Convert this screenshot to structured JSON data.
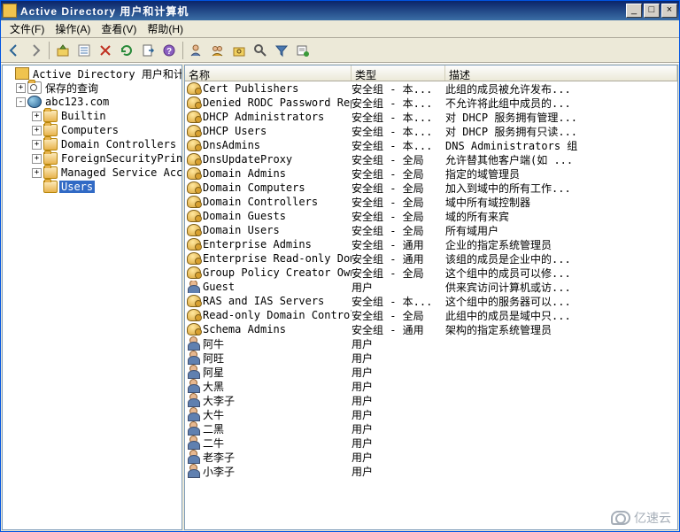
{
  "window": {
    "title": "Active Directory 用户和计算机",
    "min_label": "_",
    "max_label": "□",
    "close_label": "×"
  },
  "menu": {
    "file": "文件(F)",
    "action": "操作(A)",
    "view": "查看(V)",
    "help": "帮助(H)"
  },
  "tree": {
    "root": "Active Directory 用户和计算机",
    "saved_queries": "保存的查询",
    "domain": "abc123.com",
    "children": [
      {
        "label": "Builtin",
        "exp": "+"
      },
      {
        "label": "Computers",
        "exp": "+"
      },
      {
        "label": "Domain Controllers",
        "exp": "+"
      },
      {
        "label": "ForeignSecurityPrincipals",
        "exp": "+"
      },
      {
        "label": "Managed Service Accounts",
        "exp": "+"
      },
      {
        "label": "Users",
        "exp": "",
        "selected": true
      }
    ]
  },
  "columns": {
    "name": "名称",
    "type": "类型",
    "desc": "描述"
  },
  "items": [
    {
      "icon": "grp",
      "name": "Cert Publishers",
      "type": "安全组 - 本...",
      "desc": "此组的成员被允许发布..."
    },
    {
      "icon": "grp",
      "name": "Denied RODC Password Rep...",
      "type": "安全组 - 本...",
      "desc": "不允许将此组中成员的..."
    },
    {
      "icon": "grp",
      "name": "DHCP Administrators",
      "type": "安全组 - 本...",
      "desc": "对 DHCP 服务拥有管理..."
    },
    {
      "icon": "grp",
      "name": "DHCP Users",
      "type": "安全组 - 本...",
      "desc": "对 DHCP 服务拥有只读..."
    },
    {
      "icon": "grp",
      "name": "DnsAdmins",
      "type": "安全组 - 本...",
      "desc": "DNS Administrators 组"
    },
    {
      "icon": "grp",
      "name": "DnsUpdateProxy",
      "type": "安全组 - 全局",
      "desc": "允许替其他客户端(如 ..."
    },
    {
      "icon": "grp",
      "name": "Domain Admins",
      "type": "安全组 - 全局",
      "desc": "指定的域管理员"
    },
    {
      "icon": "grp",
      "name": "Domain Computers",
      "type": "安全组 - 全局",
      "desc": "加入到域中的所有工作..."
    },
    {
      "icon": "grp",
      "name": "Domain Controllers",
      "type": "安全组 - 全局",
      "desc": "域中所有域控制器"
    },
    {
      "icon": "grp",
      "name": "Domain Guests",
      "type": "安全组 - 全局",
      "desc": "域的所有来宾"
    },
    {
      "icon": "grp",
      "name": "Domain Users",
      "type": "安全组 - 全局",
      "desc": "所有域用户"
    },
    {
      "icon": "grp",
      "name": "Enterprise Admins",
      "type": "安全组 - 通用",
      "desc": "企业的指定系统管理员"
    },
    {
      "icon": "grp",
      "name": "Enterprise Read-only Dom...",
      "type": "安全组 - 通用",
      "desc": "该组的成员是企业中的..."
    },
    {
      "icon": "grp",
      "name": "Group Policy Creator Owners",
      "type": "安全组 - 全局",
      "desc": "这个组中的成员可以修..."
    },
    {
      "icon": "usr",
      "name": "Guest",
      "type": "用户",
      "desc": "供来宾访问计算机或访..."
    },
    {
      "icon": "grp",
      "name": "RAS and IAS Servers",
      "type": "安全组 - 本...",
      "desc": "这个组中的服务器可以..."
    },
    {
      "icon": "grp",
      "name": "Read-only Domain Control...",
      "type": "安全组 - 全局",
      "desc": "此组中的成员是域中只..."
    },
    {
      "icon": "grp",
      "name": "Schema Admins",
      "type": "安全组 - 通用",
      "desc": "架构的指定系统管理员"
    },
    {
      "icon": "usr",
      "name": "阿牛",
      "type": "用户",
      "desc": ""
    },
    {
      "icon": "usr",
      "name": "阿旺",
      "type": "用户",
      "desc": ""
    },
    {
      "icon": "usr",
      "name": "阿星",
      "type": "用户",
      "desc": ""
    },
    {
      "icon": "usr",
      "name": "大黑",
      "type": "用户",
      "desc": ""
    },
    {
      "icon": "usr",
      "name": "大李子",
      "type": "用户",
      "desc": ""
    },
    {
      "icon": "usr",
      "name": "大牛",
      "type": "用户",
      "desc": ""
    },
    {
      "icon": "usr",
      "name": "二黑",
      "type": "用户",
      "desc": ""
    },
    {
      "icon": "usr",
      "name": "二牛",
      "type": "用户",
      "desc": ""
    },
    {
      "icon": "usr",
      "name": "老李子",
      "type": "用户",
      "desc": ""
    },
    {
      "icon": "usr",
      "name": "小李子",
      "type": "用户",
      "desc": ""
    }
  ],
  "watermark": "亿速云"
}
